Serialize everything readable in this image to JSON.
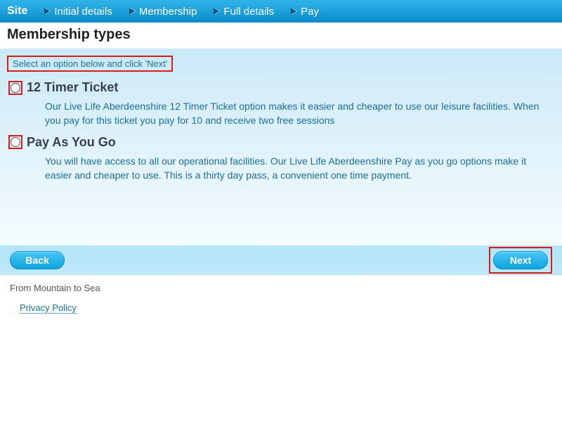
{
  "breadcrumb": {
    "site_label": "Site",
    "items": [
      {
        "label": "Initial details"
      },
      {
        "label": "Membership"
      },
      {
        "label": "Full details"
      },
      {
        "label": "Pay"
      }
    ]
  },
  "page_title": "Membership types",
  "instruction": "Select an option below and click 'Next'",
  "options": [
    {
      "title": "12 Timer Ticket",
      "description": "Our Live Life Aberdeenshire 12 Timer Ticket option makes it easier and cheaper to use our leisure facilities. When you pay for this ticket you pay for 10 and receive two free sessions"
    },
    {
      "title": "Pay As You Go",
      "description": "You will have access to all our operational facilities. Our Live Life Aberdeenshire Pay as you go options make it easier and cheaper to use. This is a thirty day pass, a convenient one time payment."
    }
  ],
  "buttons": {
    "back": "Back",
    "next": "Next"
  },
  "footer": {
    "tagline": "From Mountain to Sea",
    "privacy": "Privacy Policy"
  }
}
